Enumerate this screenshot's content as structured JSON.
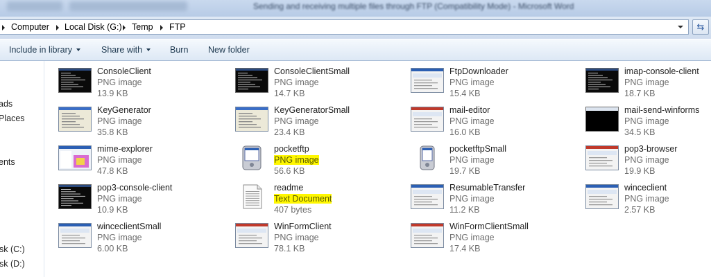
{
  "window": {
    "title_blurred": "Sending and receiving multiple files through FTP (Compatibility Mode) - Microsoft Word"
  },
  "address_bar": {
    "crumbs": [
      "Computer",
      "Local Disk (G:)",
      "Temp",
      "FTP"
    ],
    "refresh_icon": "refresh-icon"
  },
  "toolbar": {
    "include_in_library": "Include in library",
    "share_with": "Share with",
    "burn": "Burn",
    "new_folder": "New folder"
  },
  "nav": {
    "items": [
      "ads",
      "Places",
      "ents",
      "sk (C:)",
      "sk (D:)"
    ]
  },
  "files": [
    {
      "name": "ConsoleClient",
      "type": "PNG image",
      "size": "13.9 KB",
      "thumb": "console"
    },
    {
      "name": "ConsoleClientSmall",
      "type": "PNG image",
      "size": "14.7 KB",
      "thumb": "console"
    },
    {
      "name": "FtpDownloader",
      "type": "PNG image",
      "size": "15.4 KB",
      "thumb": "window"
    },
    {
      "name": "imap-console-client",
      "type": "PNG image",
      "size": "18.7 KB",
      "thumb": "console"
    },
    {
      "name": "KeyGenerator",
      "type": "PNG image",
      "size": "35.8 KB",
      "thumb": "dialog"
    },
    {
      "name": "KeyGeneratorSmall",
      "type": "PNG image",
      "size": "23.4 KB",
      "thumb": "dialog"
    },
    {
      "name": "mail-editor",
      "type": "PNG image",
      "size": "16.0 KB",
      "thumb": "window-red"
    },
    {
      "name": "mail-send-winforms",
      "type": "PNG image",
      "size": "34.5 KB",
      "thumb": "black"
    },
    {
      "name": "mime-explorer",
      "type": "PNG image",
      "size": "47.8 KB",
      "thumb": "explorer"
    },
    {
      "name": "pocketftp",
      "type": "PNG image",
      "size": "56.6 KB",
      "thumb": "pda",
      "highlight_type": true
    },
    {
      "name": "pocketftpSmall",
      "type": "PNG image",
      "size": "19.7 KB",
      "thumb": "pda-small"
    },
    {
      "name": "pop3-browser",
      "type": "PNG image",
      "size": "19.9 KB",
      "thumb": "window-red"
    },
    {
      "name": "pop3-console-client",
      "type": "PNG image",
      "size": "10.9 KB",
      "thumb": "console"
    },
    {
      "name": "readme",
      "type": "Text Document",
      "size": "407 bytes",
      "thumb": "text",
      "highlight_type": true
    },
    {
      "name": "ResumableTransfer",
      "type": "PNG image",
      "size": "11.2 KB",
      "thumb": "window"
    },
    {
      "name": "winceclient",
      "type": "PNG image",
      "size": "2.57 KB",
      "thumb": "window"
    },
    {
      "name": "winceclientSmall",
      "type": "PNG image",
      "size": "6.00 KB",
      "thumb": "window"
    },
    {
      "name": "WinFormClient",
      "type": "PNG image",
      "size": "78.1 KB",
      "thumb": "window-red"
    },
    {
      "name": "WinFormClientSmall",
      "type": "PNG image",
      "size": "17.4 KB",
      "thumb": "window-red"
    }
  ],
  "colors": {
    "highlight": "#fff700",
    "accent": "#2c5aa0"
  }
}
